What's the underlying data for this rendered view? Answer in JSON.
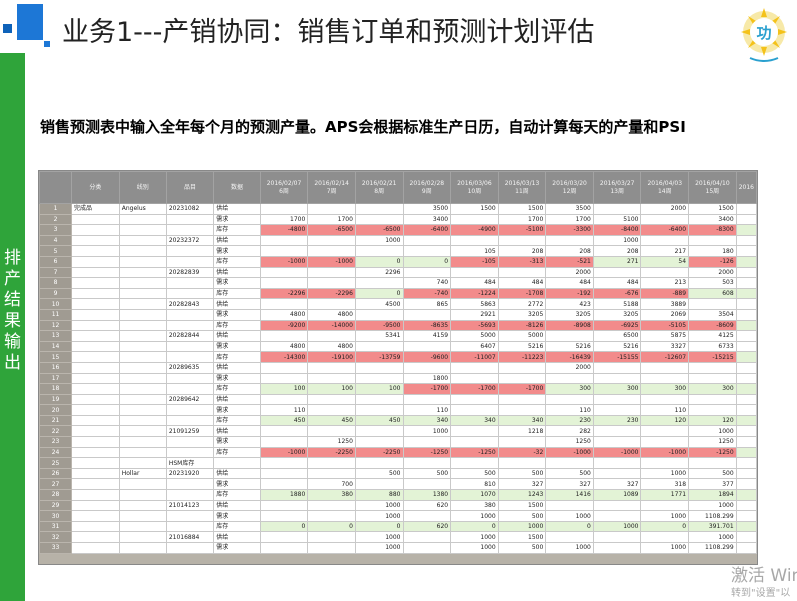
{
  "slide": {
    "title": "业务1---产销协同：销售订单和预测计划评估",
    "subtitle": "销售预测表中输入全年每个月的预测产量。APS会根据标准生产日历，自动计算每天的产量和PSI",
    "sidebar_label": "排产结果输出",
    "logo_text": "功",
    "watermark_line1": "激活 Win",
    "watermark_line2": "转到\"设置\"以"
  },
  "colors": {
    "accent": "#2fa43a",
    "brand_blue": "#1d77d6",
    "negative": "#f28b8b",
    "positive": "#e3f3d6",
    "header": "#8e8e8e"
  },
  "table": {
    "headers": [
      "",
      "分类",
      "线别",
      "品目",
      "数据"
    ],
    "dates": [
      {
        "date": "2016/02/07",
        "week": "6周"
      },
      {
        "date": "2016/02/14",
        "week": "7周"
      },
      {
        "date": "2016/02/21",
        "week": "8周"
      },
      {
        "date": "2016/02/28",
        "week": "9周"
      },
      {
        "date": "2016/03/06",
        "week": "10周"
      },
      {
        "date": "2016/03/13",
        "week": "11周"
      },
      {
        "date": "2016/03/20",
        "week": "12周"
      },
      {
        "date": "2016/03/27",
        "week": "13周"
      },
      {
        "date": "2016/04/03",
        "week": "14周"
      },
      {
        "date": "2016/04/10",
        "week": "15周"
      },
      {
        "date": "2016",
        "week": ""
      }
    ],
    "rows": [
      {
        "n": "1",
        "cat": "完成品",
        "line": "Angelus",
        "item": "20231082",
        "type": "供给",
        "v": [
          "",
          "",
          "",
          "3500",
          "1500",
          "1500",
          "3500",
          "",
          "2000",
          "1500",
          ""
        ]
      },
      {
        "n": "2",
        "cat": "",
        "line": "",
        "item": "",
        "type": "需求",
        "v": [
          "1700",
          "1700",
          "",
          "3400",
          "",
          "1700",
          "1700",
          "5100",
          "",
          "3400",
          ""
        ]
      },
      {
        "n": "3",
        "cat": "",
        "line": "",
        "item": "",
        "type": "库存",
        "v": [
          "-4800",
          "-6500",
          "-6500",
          "-6400",
          "-4900",
          "-5100",
          "-3300",
          "-8400",
          "-6400",
          "-8300",
          ""
        ]
      },
      {
        "n": "4",
        "cat": "",
        "line": "",
        "item": "20232372",
        "type": "供给",
        "v": [
          "",
          "",
          "1000",
          "",
          "",
          "",
          "",
          "1000",
          "",
          "",
          ""
        ]
      },
      {
        "n": "5",
        "cat": "",
        "line": "",
        "item": "",
        "type": "需求",
        "v": [
          "",
          "",
          "",
          "",
          "105",
          "208",
          "208",
          "208",
          "217",
          "180",
          ""
        ]
      },
      {
        "n": "6",
        "cat": "",
        "line": "",
        "item": "",
        "type": "库存",
        "v": [
          "-1000",
          "-1000",
          "0",
          "0",
          "-105",
          "-313",
          "-521",
          "271",
          "54",
          "-126",
          ""
        ]
      },
      {
        "n": "7",
        "cat": "",
        "line": "",
        "item": "20282839",
        "type": "供给",
        "v": [
          "",
          "",
          "2296",
          "",
          "",
          "",
          "2000",
          "",
          "",
          "2000",
          ""
        ]
      },
      {
        "n": "8",
        "cat": "",
        "line": "",
        "item": "",
        "type": "需求",
        "v": [
          "",
          "",
          "",
          "740",
          "484",
          "484",
          "484",
          "484",
          "213",
          "503",
          ""
        ]
      },
      {
        "n": "9",
        "cat": "",
        "line": "",
        "item": "",
        "type": "库存",
        "v": [
          "-2296",
          "-2296",
          "0",
          "-740",
          "-1224",
          "-1708",
          "-192",
          "-676",
          "-889",
          "608",
          ""
        ]
      },
      {
        "n": "10",
        "cat": "",
        "line": "",
        "item": "20282843",
        "type": "供给",
        "v": [
          "",
          "",
          "4500",
          "865",
          "5863",
          "2772",
          "423",
          "5188",
          "3889",
          "",
          ""
        ]
      },
      {
        "n": "11",
        "cat": "",
        "line": "",
        "item": "",
        "type": "需求",
        "v": [
          "4800",
          "4800",
          "",
          "",
          "2921",
          "3205",
          "3205",
          "3205",
          "2069",
          "3504",
          ""
        ]
      },
      {
        "n": "12",
        "cat": "",
        "line": "",
        "item": "",
        "type": "库存",
        "v": [
          "-9200",
          "-14000",
          "-9500",
          "-8635",
          "-5693",
          "-8126",
          "-8908",
          "-6925",
          "-5105",
          "-8609",
          ""
        ]
      },
      {
        "n": "13",
        "cat": "",
        "line": "",
        "item": "20282844",
        "type": "供给",
        "v": [
          "",
          "",
          "5341",
          "4159",
          "5000",
          "5000",
          "",
          "6500",
          "5875",
          "4125",
          ""
        ]
      },
      {
        "n": "14",
        "cat": "",
        "line": "",
        "item": "",
        "type": "需求",
        "v": [
          "4800",
          "4800",
          "",
          "",
          "6407",
          "5216",
          "5216",
          "5216",
          "3327",
          "6733",
          ""
        ]
      },
      {
        "n": "15",
        "cat": "",
        "line": "",
        "item": "",
        "type": "库存",
        "v": [
          "-14300",
          "-19100",
          "-13759",
          "-9600",
          "-11007",
          "-11223",
          "-16439",
          "-15155",
          "-12607",
          "-15215",
          ""
        ]
      },
      {
        "n": "16",
        "cat": "",
        "line": "",
        "item": "20289635",
        "type": "供给",
        "v": [
          "",
          "",
          "",
          "",
          "",
          "",
          "2000",
          "",
          "",
          "",
          ""
        ]
      },
      {
        "n": "17",
        "cat": "",
        "line": "",
        "item": "",
        "type": "需求",
        "v": [
          "",
          "",
          "",
          "1800",
          "",
          "",
          "",
          "",
          "",
          "",
          ""
        ]
      },
      {
        "n": "18",
        "cat": "",
        "line": "",
        "item": "",
        "type": "库存",
        "v": [
          "100",
          "100",
          "100",
          "-1700",
          "-1700",
          "-1700",
          "300",
          "300",
          "300",
          "300",
          ""
        ]
      },
      {
        "n": "19",
        "cat": "",
        "line": "",
        "item": "20289642",
        "type": "供给",
        "v": [
          "",
          "",
          "",
          "",
          "",
          "",
          "",
          "",
          "",
          "",
          ""
        ]
      },
      {
        "n": "20",
        "cat": "",
        "line": "",
        "item": "",
        "type": "需求",
        "v": [
          "110",
          "",
          "",
          "110",
          "",
          "",
          "110",
          "",
          "110",
          "",
          ""
        ]
      },
      {
        "n": "21",
        "cat": "",
        "line": "",
        "item": "",
        "type": "库存",
        "v": [
          "450",
          "450",
          "450",
          "340",
          "340",
          "340",
          "230",
          "230",
          "120",
          "120",
          ""
        ]
      },
      {
        "n": "22",
        "cat": "",
        "line": "",
        "item": "21091259",
        "type": "供给",
        "v": [
          "",
          "",
          "",
          "1000",
          "",
          "1218",
          "282",
          "",
          "",
          "1000",
          ""
        ]
      },
      {
        "n": "23",
        "cat": "",
        "line": "",
        "item": "",
        "type": "需求",
        "v": [
          "",
          "1250",
          "",
          "",
          "",
          "",
          "1250",
          "",
          "",
          "1250",
          ""
        ]
      },
      {
        "n": "24",
        "cat": "",
        "line": "",
        "item": "",
        "type": "库存",
        "v": [
          "-1000",
          "-2250",
          "-2250",
          "-1250",
          "-1250",
          "-32",
          "-1000",
          "-1000",
          "-1000",
          "-1250",
          ""
        ]
      },
      {
        "n": "25",
        "cat": "",
        "line": "",
        "item": "HSM库存",
        "type": "",
        "v": [
          "",
          "",
          "",
          "",
          "",
          "",
          "",
          "",
          "",
          "",
          ""
        ]
      },
      {
        "n": "26",
        "cat": "",
        "line": "Hollar",
        "item": "20231920",
        "type": "供给",
        "v": [
          "",
          "",
          "500",
          "500",
          "500",
          "500",
          "500",
          "",
          "1000",
          "500",
          ""
        ]
      },
      {
        "n": "27",
        "cat": "",
        "line": "",
        "item": "",
        "type": "需求",
        "v": [
          "",
          "700",
          "",
          "",
          "810",
          "327",
          "327",
          "327",
          "318",
          "377",
          ""
        ]
      },
      {
        "n": "28",
        "cat": "",
        "line": "",
        "item": "",
        "type": "库存",
        "v": [
          "1880",
          "380",
          "880",
          "1380",
          "1070",
          "1243",
          "1416",
          "1089",
          "1771",
          "1894",
          ""
        ]
      },
      {
        "n": "29",
        "cat": "",
        "line": "",
        "item": "21014123",
        "type": "供给",
        "v": [
          "",
          "",
          "1000",
          "620",
          "380",
          "1500",
          "",
          "",
          "",
          "1000",
          ""
        ]
      },
      {
        "n": "30",
        "cat": "",
        "line": "",
        "item": "",
        "type": "需求",
        "v": [
          "",
          "",
          "1000",
          "",
          "1000",
          "500",
          "1000",
          "",
          "1000",
          "1108.299",
          ""
        ]
      },
      {
        "n": "31",
        "cat": "",
        "line": "",
        "item": "",
        "type": "库存",
        "v": [
          "0",
          "0",
          "0",
          "620",
          "0",
          "1000",
          "0",
          "1000",
          "0",
          "391.701",
          ""
        ]
      },
      {
        "n": "32",
        "cat": "",
        "line": "",
        "item": "21016884",
        "type": "供给",
        "v": [
          "",
          "",
          "1000",
          "",
          "1000",
          "1500",
          "",
          "",
          "",
          "1000",
          ""
        ]
      },
      {
        "n": "33",
        "cat": "",
        "line": "",
        "item": "",
        "type": "需求",
        "v": [
          "",
          "",
          "1000",
          "",
          "1000",
          "500",
          "1000",
          "",
          "1000",
          "1108.299",
          ""
        ]
      }
    ]
  }
}
